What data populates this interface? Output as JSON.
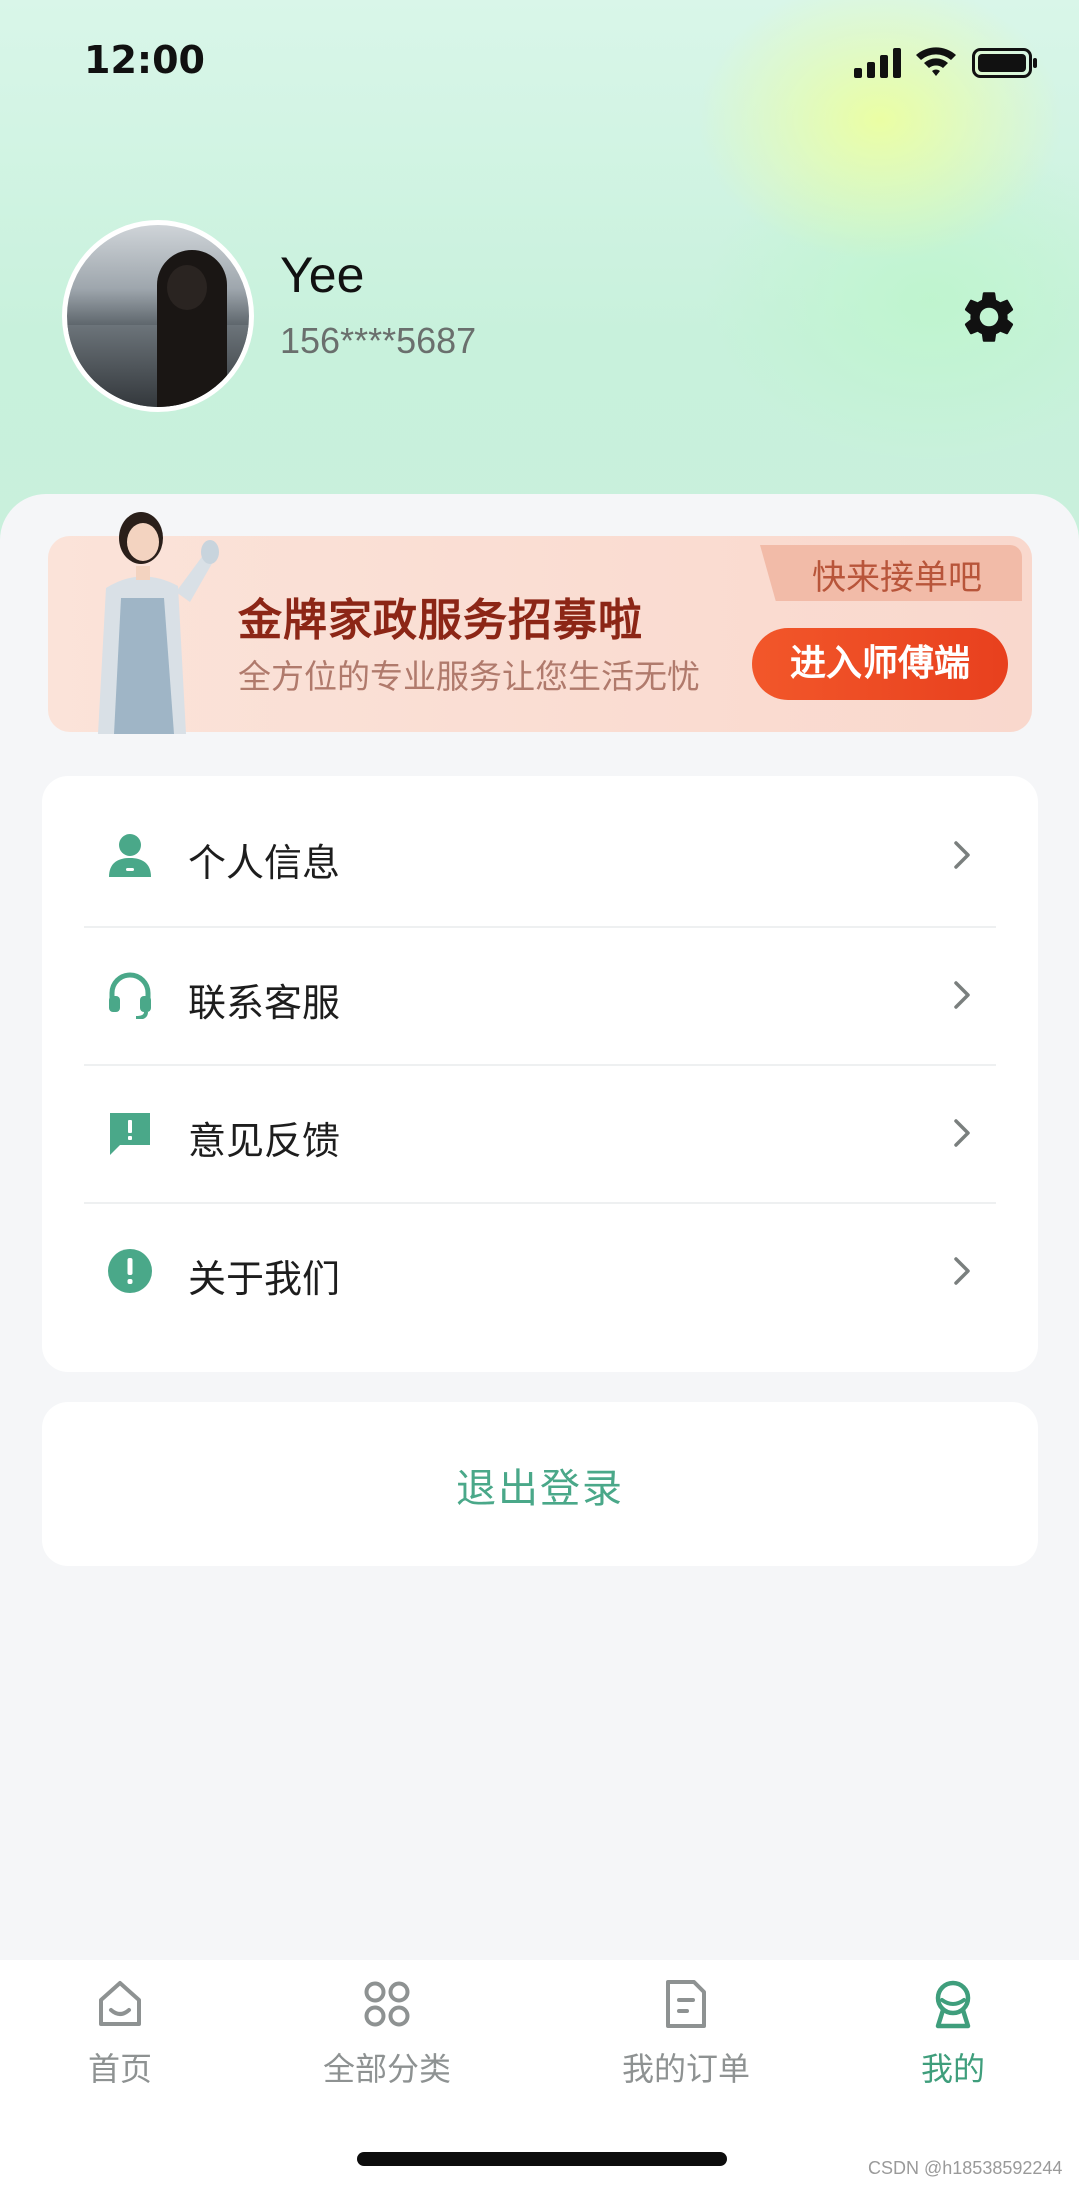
{
  "status_bar": {
    "time": "12:00"
  },
  "profile": {
    "name": "Yee",
    "phone": "156****5687"
  },
  "banner": {
    "tag": "快来接单吧",
    "title": "金牌家政服务招募啦",
    "subtitle": "全方位的专业服务让您生活无忧",
    "button": "进入师傅端"
  },
  "menu": {
    "items": [
      {
        "label": "个人信息",
        "icon": "person-icon"
      },
      {
        "label": "联系客服",
        "icon": "headset-icon"
      },
      {
        "label": "意见反馈",
        "icon": "feedback-icon"
      },
      {
        "label": "关于我们",
        "icon": "info-icon"
      }
    ]
  },
  "logout": {
    "label": "退出登录"
  },
  "tab_bar": {
    "tabs": [
      {
        "label": "首页",
        "icon": "home-icon",
        "active": false
      },
      {
        "label": "全部分类",
        "icon": "category-icon",
        "active": false
      },
      {
        "label": "我的订单",
        "icon": "order-icon",
        "active": false
      },
      {
        "label": "我的",
        "icon": "profile-icon",
        "active": true
      }
    ]
  },
  "watermark": "CSDN @h18538592244",
  "colors": {
    "accent": "#3f9e7c",
    "banner_button": "#e8401e",
    "inactive_tab": "#8e9292"
  }
}
